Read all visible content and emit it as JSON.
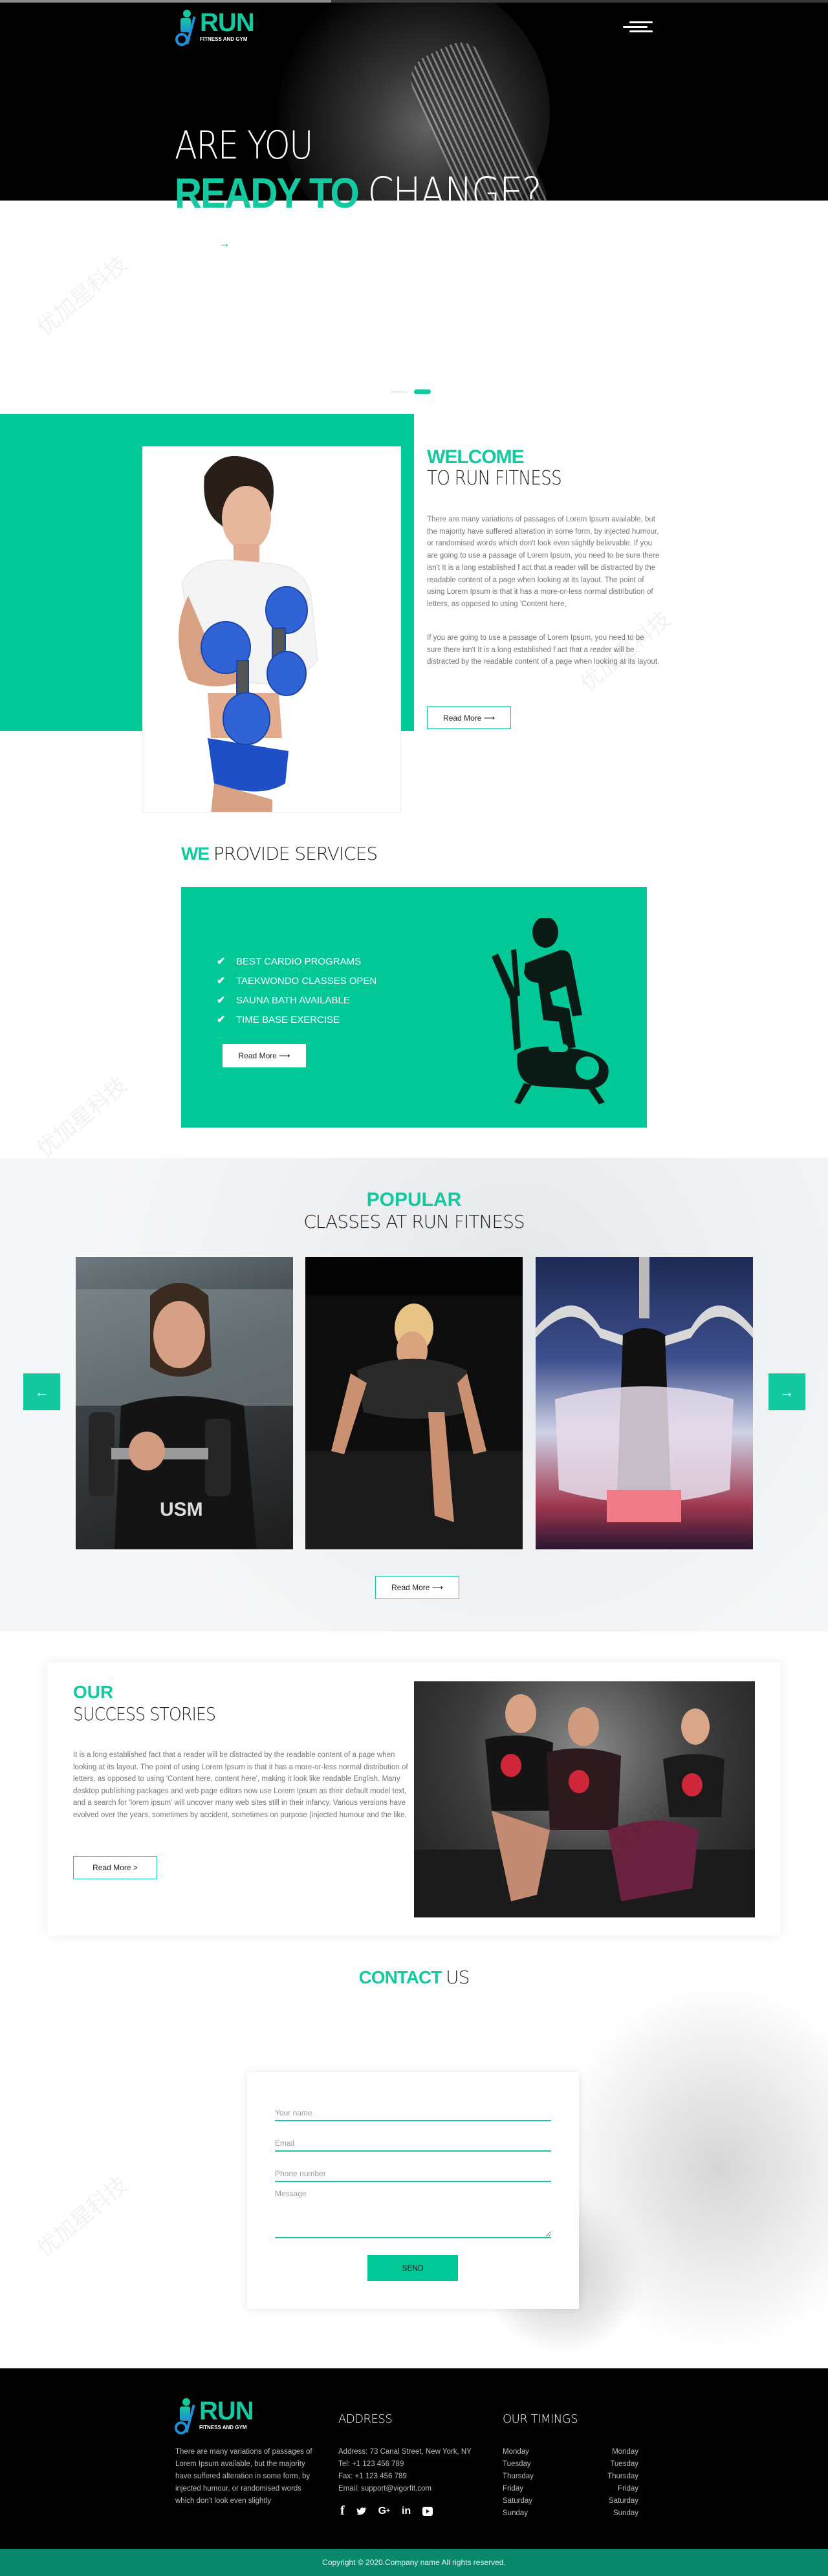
{
  "brand": {
    "name": "RUN",
    "tagline": "FITNESS AND GYM",
    "accent_color": "#14C9A0",
    "green_block_color": "#02C898",
    "footer_bar_color": "#08896B"
  },
  "header": {
    "menu_icon": "hamburger-menu-icon"
  },
  "hero": {
    "line1": "ARE YOU",
    "line2_highlight": "READY TO",
    "line2_rest": "CHANGE?",
    "arrow_icon": "→",
    "slider": {
      "slides": 2,
      "active": 2
    }
  },
  "welcome": {
    "title_highlight": "WELCOME",
    "title_rest": "TO RUN FITNESS",
    "paragraph1": "There are many variations of passages of Lorem Ipsum available, but the majority have suffered alteration in some form, by injected humour, or randomised words which don't look even slightly believable. If you are going to use a passage of Lorem Ipsum, you need to be sure there isn't It is a long established f act that a reader will be distracted by the readable content of a page when looking at its layout. The point of using Lorem Ipsum is that it has a more-or-less normal distribution of letters, as opposed to using 'Content here,",
    "paragraph2": "If you are going to use a passage of Lorem Ipsum, you need to be sure there isn't It is a long established f act that a reader will be distracted by the readable content of a page when looking at its layout.",
    "button_label": "Read More ⟶",
    "image_alt": "Woman holding blue dumbbells"
  },
  "services": {
    "title_highlight": "WE",
    "title_rest": "PROVIDE SERVICES",
    "items": [
      "BEST CARDIO PROGRAMS",
      "TAEKWONDO CLASSES OPEN",
      "SAUNA BATH AVAILABLE",
      "TIME BASE EXERCISE"
    ],
    "check_icon": "✔",
    "button_label": "Read More ⟶",
    "illustration": "elliptical-trainer-icon"
  },
  "classes": {
    "title_highlight": "POPULAR",
    "title_rest": "CLASSES AT RUN FITNESS",
    "prev_icon": "←",
    "next_icon": "→",
    "images": [
      {
        "alt": "Woman lifting dumbbell in gym"
      },
      {
        "alt": "Woman doing push-up on dark floor"
      },
      {
        "alt": "Woman doing lat pulldown, back view"
      }
    ],
    "button_label": "Read More ⟶"
  },
  "success": {
    "title_highlight": "OUR",
    "title_rest": "SUCCESS STORIES",
    "paragraph": "It is a long established fact that a reader will be distracted by the readable content of a page when looking at its layout. The point of using Lorem Ipsum is that it has a more-or-less normal distribution of letters, as opposed to using 'Content here, content here', making it look like readable English. Many desktop publishing packages and web page editors now use Lorem Ipsum as their default model text, and a search for 'lorem ipsum' will uncover many web sites still in their infancy. Various versions have evolved over the years, sometimes by accident, sometimes on purpose (injected humour and the like.",
    "button_label": "Read More >",
    "image_alt": "Group doing twist exercise with red kettlebells"
  },
  "contact": {
    "title_highlight": "CONTACT",
    "title_rest": "US",
    "fields": {
      "name_placeholder": "Your name",
      "email_placeholder": "Email",
      "phone_placeholder": "Phone number",
      "message_placeholder": "Message"
    },
    "send_label": "SEND"
  },
  "footer": {
    "description": "There are many variations of passages of Lorem Ipsum available, but the majority have suffered alteration in some form, by injected humour, or randomised words which don't look even slightly",
    "address_heading": "ADDRESS",
    "address_lines": [
      "Address: 73 Canal Street, New York, NY",
      "Tel: +1 123 456 789",
      "Fax: +1 123 456 789",
      "Email: support@vigorfit.com"
    ],
    "social": [
      {
        "name": "facebook",
        "glyph": "f"
      },
      {
        "name": "twitter",
        "glyph": "🐦"
      },
      {
        "name": "google-plus",
        "glyph": "G+"
      },
      {
        "name": "linkedin",
        "glyph": "in"
      },
      {
        "name": "youtube",
        "glyph": "▶"
      }
    ],
    "timings_heading": "OUR TIMINGS",
    "timings_left": [
      "Monday",
      "Tuesday",
      "Thursday",
      "Friday",
      "Saturday",
      "Sunday"
    ],
    "timings_right": [
      "Monday",
      "Tuesday",
      "Thursday",
      "Friday",
      "Saturday",
      "Sunday"
    ],
    "copyright": "Copyright © 2020.Company name All rights reserved."
  }
}
